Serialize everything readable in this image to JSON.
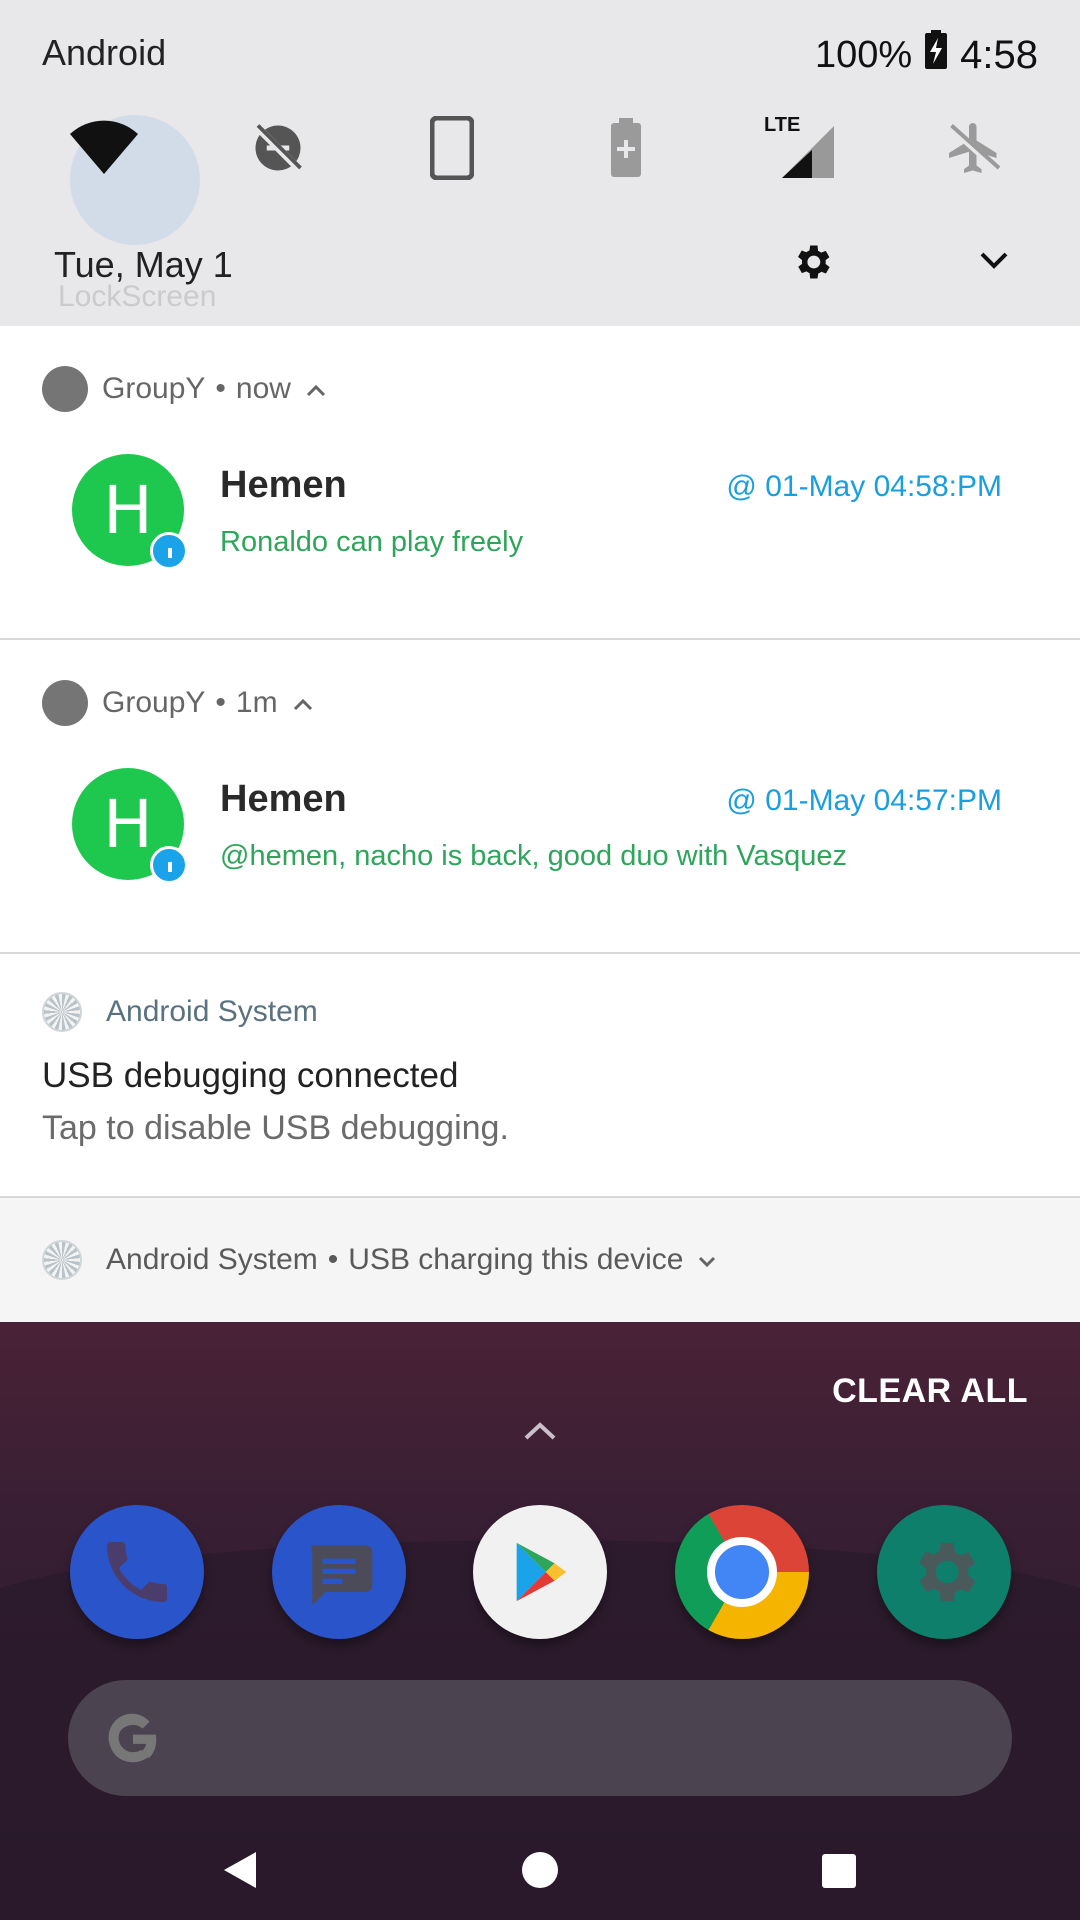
{
  "status_bar": {
    "carrier": "Android",
    "battery": "100%",
    "time": "4:58"
  },
  "quick_settings": {
    "tiles": [
      "wifi-icon",
      "data-saver-icon",
      "auto-rotate-icon",
      "battery-saver-icon",
      "lte-signal-icon",
      "airplane-mode-icon"
    ],
    "lte_label": "LTE",
    "date": "Tue, May 1",
    "ghost_label": "LockScreen"
  },
  "notifications": [
    {
      "app": "GroupY",
      "age": "now",
      "sender": "Hemen",
      "avatar_letter": "H",
      "timestamp": "@ 01-May 04:58:PM",
      "message": "Ronaldo can play freely"
    },
    {
      "app": "GroupY",
      "age": "1m",
      "sender": "Hemen",
      "avatar_letter": "H",
      "timestamp": "@ 01-May 04:57:PM",
      "message": "@hemen, nacho is back, good duo with Vasquez"
    },
    {
      "app": "Android System",
      "title": "USB debugging connected",
      "text": "Tap to disable USB debugging."
    },
    {
      "app": "Android System",
      "summary": "USB charging this device"
    }
  ],
  "home": {
    "clear_all": "CLEAR ALL",
    "dock_apps": [
      "phone-icon",
      "messages-icon",
      "play-store-icon",
      "chrome-icon",
      "settings-icon"
    ]
  },
  "colors": {
    "avatar": "#1ec84e",
    "timestamp": "#1a9ee0",
    "message": "#2ea55a",
    "badge": "#1aa3e8"
  }
}
